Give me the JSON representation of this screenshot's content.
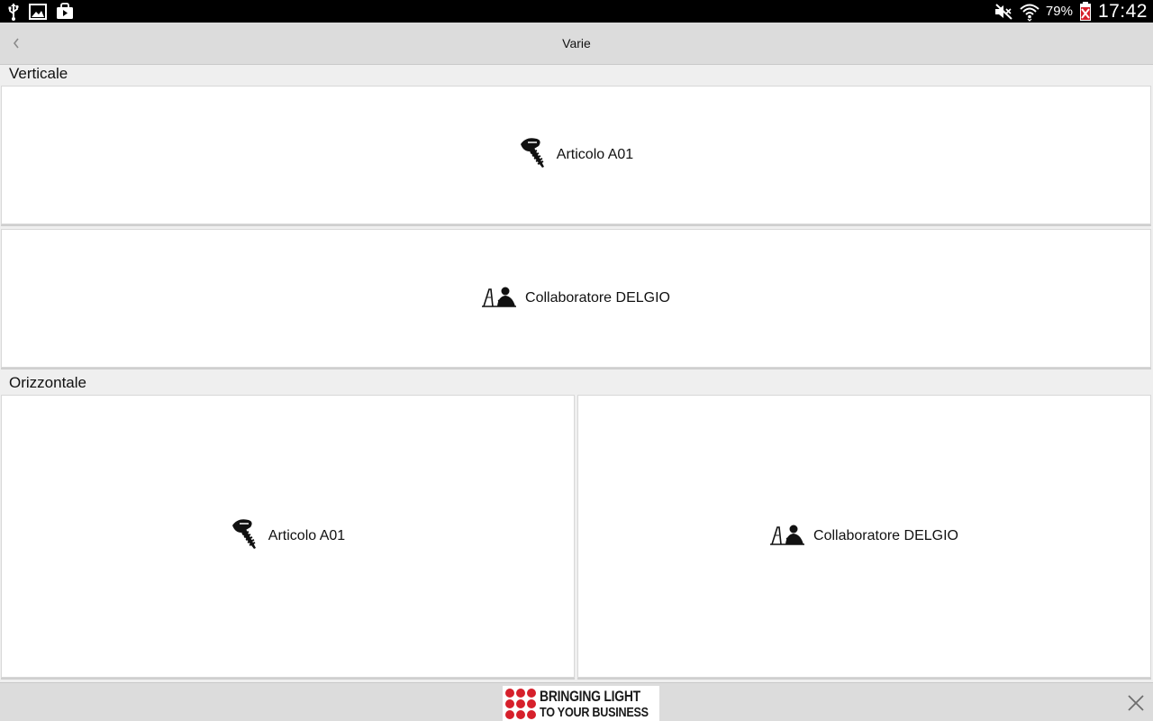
{
  "status_bar": {
    "battery_percent": "79%",
    "time": "17:42",
    "left_icons": [
      "usb-icon",
      "gallery-icon",
      "store-bag-icon"
    ],
    "right_icons": [
      "mute-icon",
      "wifi-icon",
      "battery-charging-icon"
    ]
  },
  "action_bar": {
    "back_icon": "chevron-left-icon",
    "title": "Varie"
  },
  "sections": {
    "vertical": {
      "label": "Verticale",
      "items": [
        {
          "label": "Articolo A01",
          "icon": "screw-icon"
        },
        {
          "label": "Collaboratore DELGIO",
          "icon": "worker-icon"
        }
      ]
    },
    "horizontal": {
      "label": "Orizzontale",
      "items": [
        {
          "label": "Articolo A01",
          "icon": "screw-icon"
        },
        {
          "label": "Collaboratore DELGIO",
          "icon": "worker-icon"
        }
      ]
    }
  },
  "ad_bar": {
    "banner_line1": "BRINGING LIGHT",
    "banner_line2": "TO YOUR BUSINESS",
    "accent_color": "#d6202b",
    "close_icon": "close-icon"
  }
}
